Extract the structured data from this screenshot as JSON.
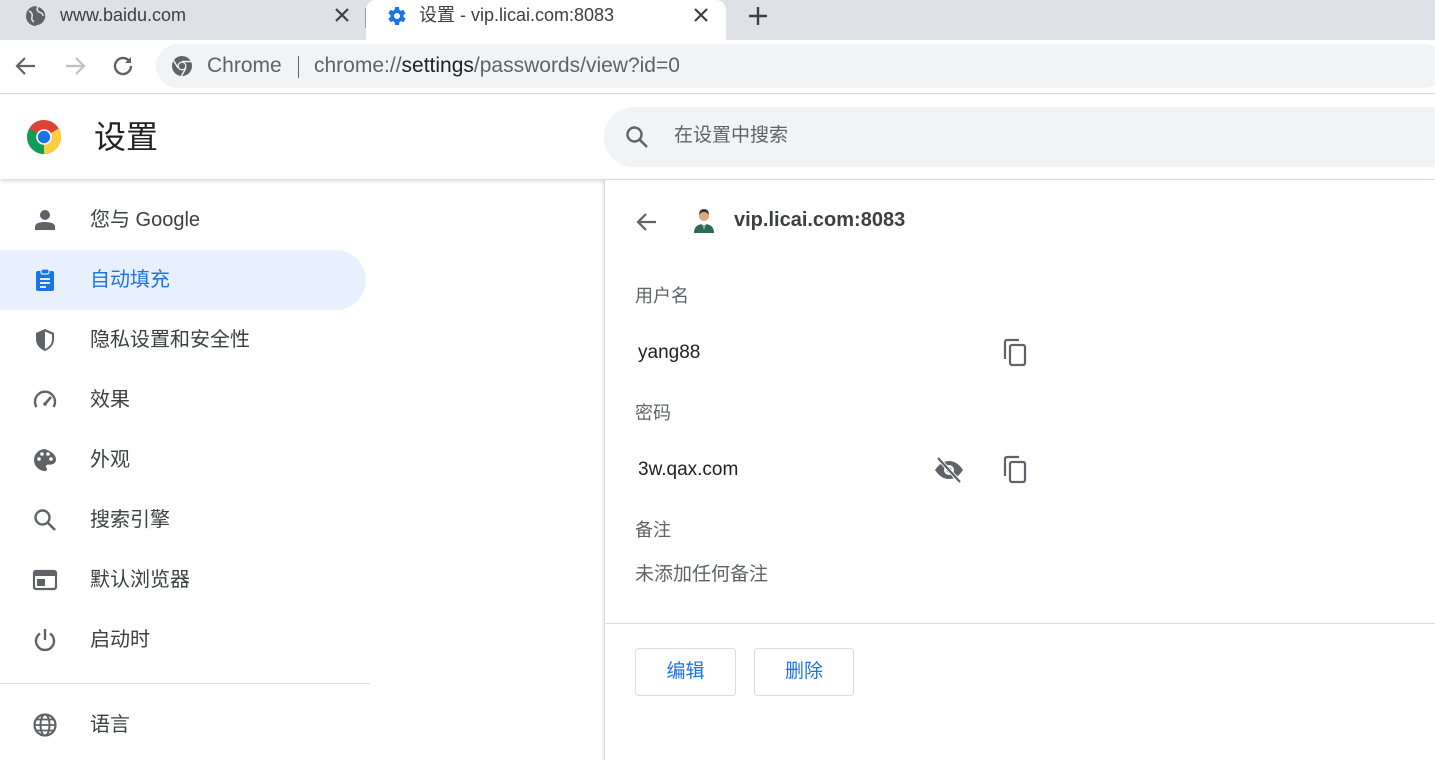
{
  "tabs": [
    {
      "title": "www.baidu.com",
      "favicon": "globe-icon",
      "active": false
    },
    {
      "title": "设置 - vip.licai.com:8083",
      "favicon": "gear-icon",
      "active": true
    }
  ],
  "toolbar": {
    "chip": "Chrome",
    "url_scheme": "chrome://",
    "url_host": "settings",
    "url_path": "/passwords/view?id=0"
  },
  "header": {
    "title": "设置",
    "search_placeholder": "在设置中搜索"
  },
  "sidebar": {
    "items": [
      {
        "label": "您与 Google",
        "icon": "person-icon"
      },
      {
        "label": "自动填充",
        "icon": "clipboard-icon",
        "active": true
      },
      {
        "label": "隐私设置和安全性",
        "icon": "shield-icon"
      },
      {
        "label": "效果",
        "icon": "speedometer-icon"
      },
      {
        "label": "外观",
        "icon": "palette-icon"
      },
      {
        "label": "搜索引擎",
        "icon": "search-icon"
      },
      {
        "label": "默认浏览器",
        "icon": "browser-window-icon"
      },
      {
        "label": "启动时",
        "icon": "power-icon"
      },
      {
        "label": "语言",
        "icon": "globe-icon"
      }
    ]
  },
  "detail": {
    "site": "vip.licai.com:8083",
    "username_label": "用户名",
    "username": "yang88",
    "password_label": "密码",
    "password": "3w.qax.com",
    "note_label": "备注",
    "note": "未添加任何备注",
    "edit_label": "编辑",
    "delete_label": "删除"
  },
  "colors": {
    "accent": "#1a73e8",
    "active_bg": "#e8f0fe",
    "tabstrip": "#dee1e6",
    "omnibox": "#f1f3f4",
    "icon": "#5f6368"
  }
}
